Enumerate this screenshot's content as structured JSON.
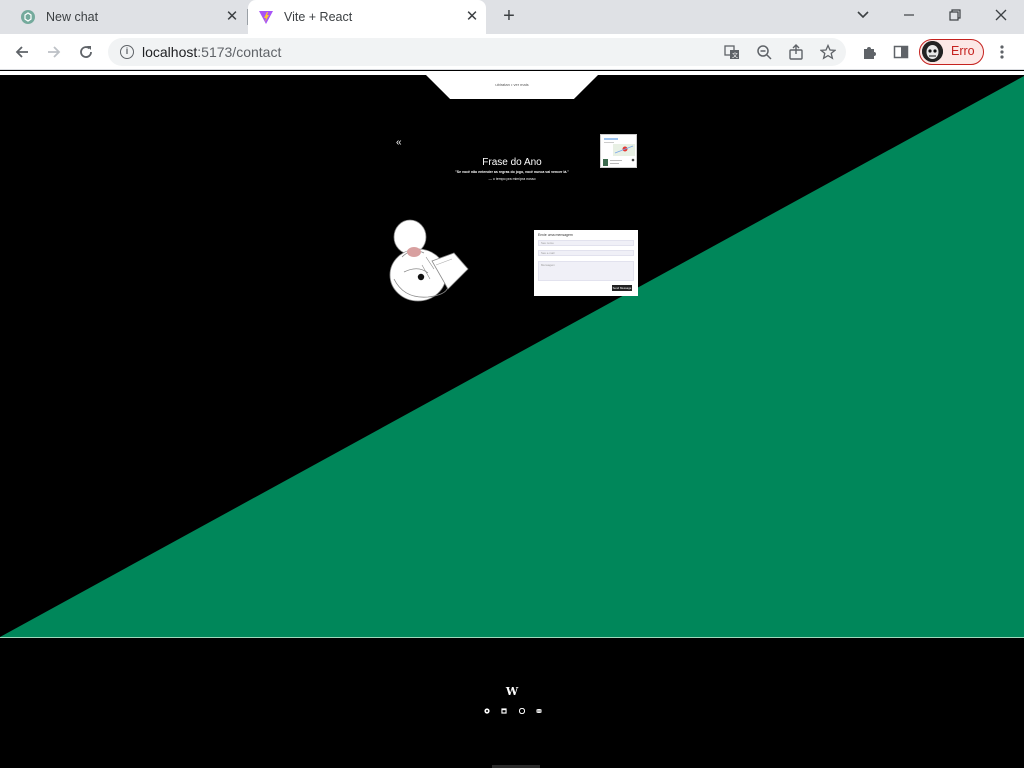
{
  "browser": {
    "tabs": [
      {
        "title": "New chat",
        "icon": "chatgpt-icon",
        "active": false
      },
      {
        "title": "Vite + React",
        "icon": "vite-icon",
        "active": true
      }
    ],
    "url_host": "localhost",
    "url_rest": ":5173/contact",
    "profile_label": "Erro",
    "colors": {
      "tabstrip": "#dfe1e5",
      "profile_error": "#c5221f"
    }
  },
  "page": {
    "nav_tab_text": "ubiratan • ver mais",
    "back_label": "«",
    "phrase_title": "Frase do Ano",
    "phrase_quote": "\"Se você não entender as regras do jogo, você nunca vai vencer lá.\"",
    "phrase_author": "— o tempo pra mim/pra nosso",
    "form": {
      "title": "Envie uma mensagem",
      "name_placeholder": "Seu nome",
      "email_placeholder": "Seu e-mail",
      "message_placeholder": "Mensagem",
      "send_label": "Send Message"
    },
    "footer_logo": "W",
    "footer_icons": [
      "github-icon",
      "linkedin-icon",
      "github-alt-icon",
      "discord-icon"
    ],
    "colors": {
      "background": "#000000",
      "triangle": "#00875a",
      "footer_line": "#9fd9bd"
    }
  }
}
